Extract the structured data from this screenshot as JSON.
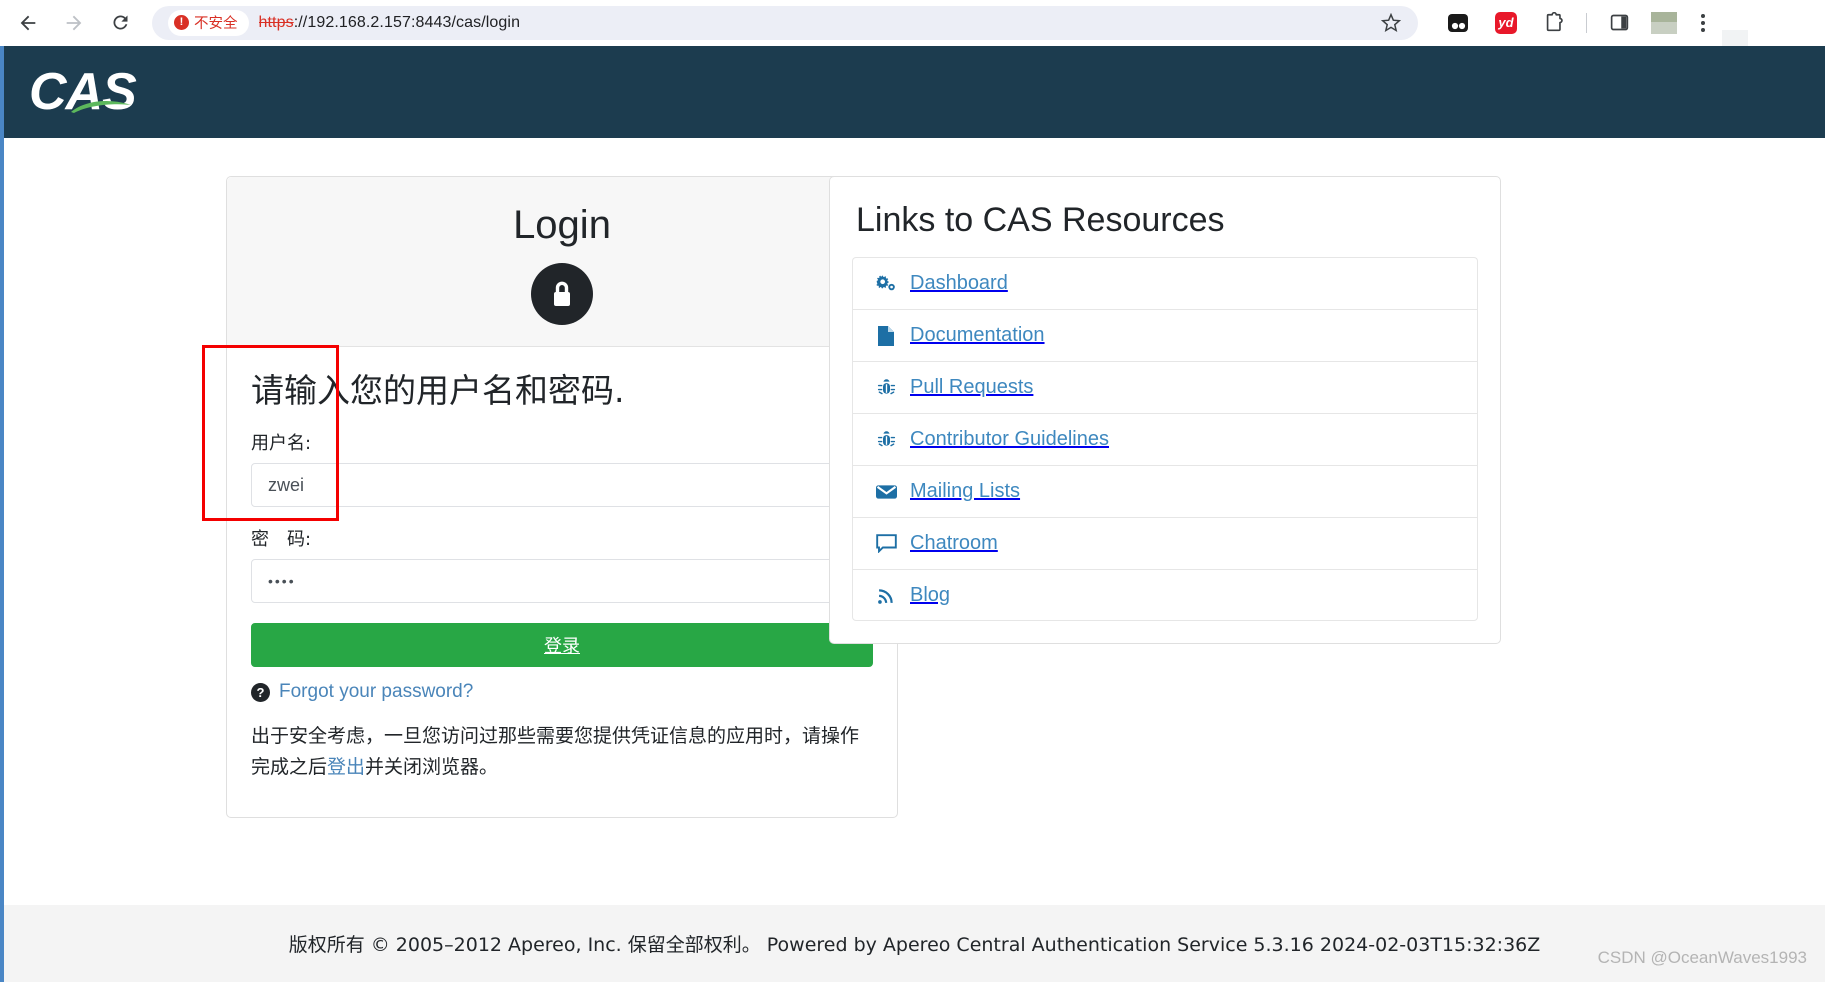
{
  "browser": {
    "back_label": "back-arrow",
    "forward_label": "forward-arrow",
    "reload_label": "reload",
    "security_badge": "不安全",
    "url_scheme": "https",
    "url_rest": "://192.168.2.157:8443/cas/login",
    "bookmark_label": "star",
    "extension_yd_label": "yd",
    "toolbar_icons": [
      "reading-list-icon",
      "yd-icon",
      "extensions-icon",
      "side-panel-icon",
      "profile-avatar",
      "menu-icon"
    ]
  },
  "header": {
    "logo_text": "CAS"
  },
  "login": {
    "panel_title": "Login",
    "lock_icon": "lock-icon",
    "form_heading": "请输入您的用户名和密码.",
    "username_label": "用户名:",
    "username_value": "zwei",
    "username_placeholder": "",
    "password_label": "密　码:",
    "password_value": "••••",
    "password_placeholder": "",
    "submit_label": "登录",
    "forgot_label": "Forgot your password?",
    "security_note_before": "出于安全考虑，一旦您访问过那些需要您提供凭证信息的应用时，请操作完成之后",
    "security_note_link": "登出",
    "security_note_after": "并关闭浏览器。"
  },
  "resources": {
    "title": "Links to CAS Resources",
    "items": [
      {
        "label": "Dashboard",
        "icon": "gears-icon"
      },
      {
        "label": "Documentation",
        "icon": "file-icon"
      },
      {
        "label": "Pull Requests",
        "icon": "bug-icon"
      },
      {
        "label": "Contributor Guidelines",
        "icon": "bug-icon"
      },
      {
        "label": "Mailing Lists",
        "icon": "envelope-icon"
      },
      {
        "label": "Chatroom",
        "icon": "comment-icon"
      },
      {
        "label": "Blog",
        "icon": "rss-icon"
      }
    ]
  },
  "footer": {
    "text": "版权所有 © 2005–2012 Apereo, Inc. 保留全部权利。 Powered by Apereo Central Authentication Service 5.3.16 2024-02-03T15:32:36Z"
  },
  "watermark": {
    "text": "CSDN @OceanWaves1993"
  },
  "colors": {
    "header_bg": "#1c3c4f",
    "submit_green": "#28a745",
    "link_blue": "#3e88bf",
    "warning_red": "#d93025",
    "annotation_red": "#f40000"
  }
}
